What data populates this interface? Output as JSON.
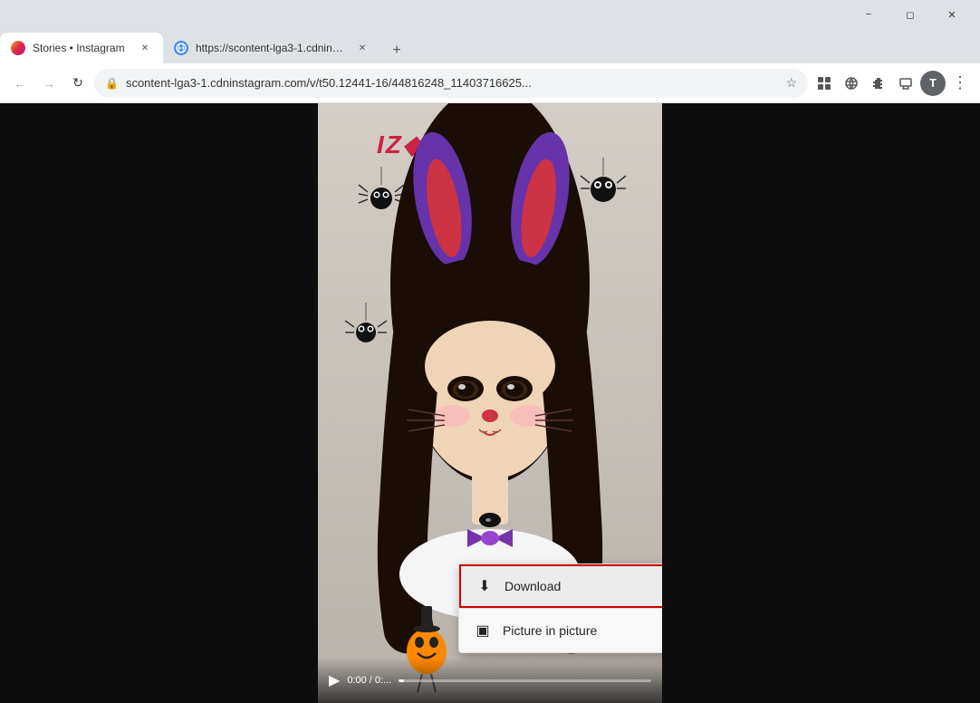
{
  "browser": {
    "title_bar": {
      "minimize_label": "−",
      "restore_label": "◻",
      "close_label": "✕"
    },
    "tabs": [
      {
        "id": "tab-instagram",
        "label": "Stories • Instagram",
        "active": true,
        "favicon_type": "instagram"
      },
      {
        "id": "tab-cdn",
        "label": "https://scontent-lga3-1.cdninsta...",
        "active": false,
        "favicon_type": "globe"
      }
    ],
    "new_tab_label": "+",
    "nav": {
      "back_label": "←",
      "forward_label": "→",
      "reload_label": "↻"
    },
    "address_bar": {
      "url": "scontent-lga3-1.cdninstagram.com/v/t50.12441-16/44816248_11403716625...",
      "lock_icon": "🔒"
    },
    "toolbar": {
      "bookmark_icon": "☆",
      "extensions_grid": "⊞",
      "translate_icon": "⊟",
      "puzzle_icon": "🧩",
      "media_icon": "≡",
      "profile_letter": "T",
      "more_icon": "⋮"
    }
  },
  "video": {
    "izzone_logo": "IZ◆ONE",
    "controls": {
      "play_icon": "▶",
      "time": "0:00 / 0:...",
      "progress_pct": 2
    }
  },
  "context_menu": {
    "items": [
      {
        "id": "download",
        "label": "Download",
        "icon": "⬇",
        "highlighted": true
      },
      {
        "id": "picture-in-picture",
        "label": "Picture in picture",
        "icon": "▣",
        "highlighted": false
      }
    ]
  }
}
